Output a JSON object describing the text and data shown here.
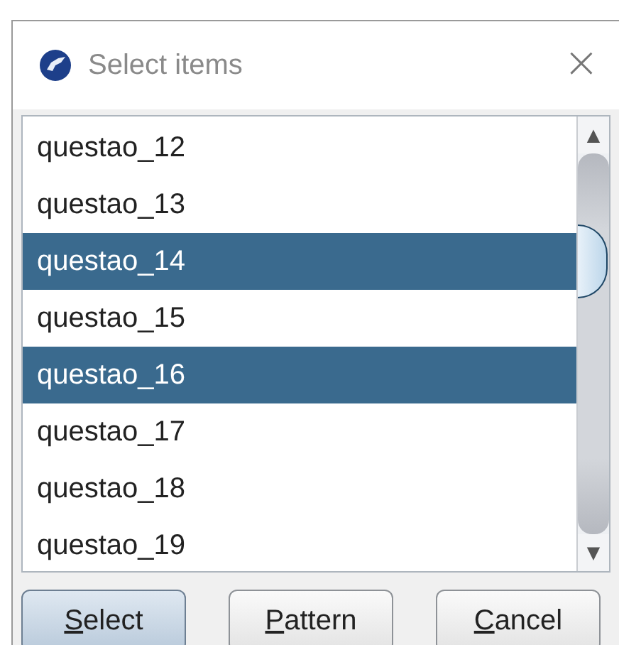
{
  "window": {
    "title": "Select items",
    "close": "×"
  },
  "items": [
    {
      "label": "questao_12",
      "selected": false
    },
    {
      "label": "questao_13",
      "selected": false
    },
    {
      "label": "questao_14",
      "selected": true
    },
    {
      "label": "questao_15",
      "selected": false
    },
    {
      "label": "questao_16",
      "selected": true
    },
    {
      "label": "questao_17",
      "selected": false
    },
    {
      "label": "questao_18",
      "selected": false
    },
    {
      "label": "questao_19",
      "selected": false
    }
  ],
  "scrollbar": {
    "up": "▲",
    "down": "▼"
  },
  "buttons": [
    {
      "label": "Select",
      "default": true
    },
    {
      "label": "Pattern",
      "default": false
    },
    {
      "label": "Cancel",
      "default": false
    }
  ]
}
